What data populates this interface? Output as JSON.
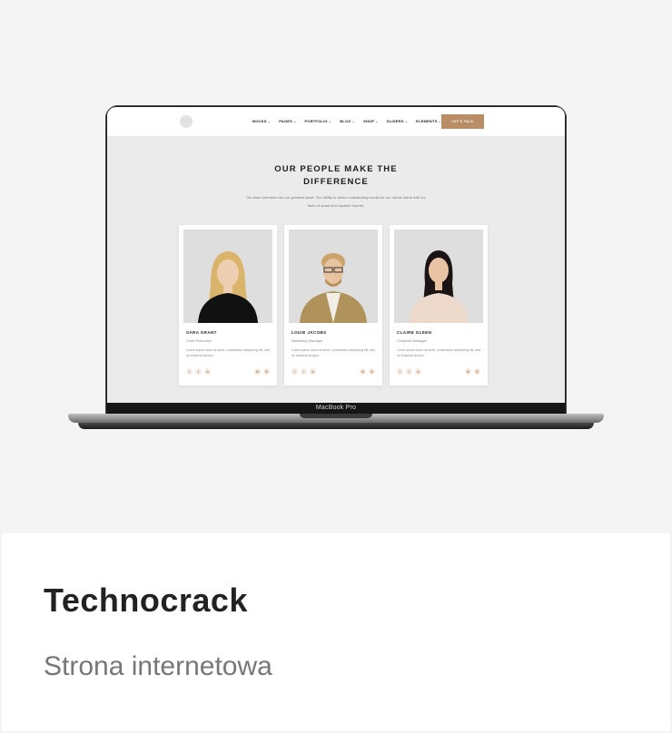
{
  "site": {
    "nav": [
      "BOOKS",
      "PAGES",
      "PORTFOLIO",
      "BLOG",
      "SHOP",
      "SLIDERS",
      "ELEMENTS"
    ],
    "cta": "LET'S TALK",
    "section_title_line1": "OUR PEOPLE MAKE THE",
    "section_title_line2": "DIFFERENCE",
    "section_sub": "Our team members are our greatest asset. Our ability to deliver outstanding results for our clients starts with our team of smart and capable experts.",
    "team": [
      {
        "name": "SARA GRANT",
        "role": "Chief Executive",
        "text": "Lorem ipsum dolor sit amet, consectetur adipiscing elit, sed do eiusmod tempor."
      },
      {
        "name": "LOUIE JACOBS",
        "role": "Marketing Manager",
        "text": "Lorem ipsum dolor sit amet, consectetur adipiscing elit, sed do eiusmod tempor."
      },
      {
        "name": "CLAIRE GLEEN",
        "role": "Financial Manager",
        "text": "Lorem ipsum dolor sit amet, consectetur adipiscing elit, sed do eiusmod tempor."
      }
    ],
    "social_icons": [
      "facebook-icon",
      "twitter-icon",
      "linkedin-icon",
      "mail-icon",
      "phone-icon"
    ],
    "accent_color": "#b98e67"
  },
  "device": {
    "label": "MacBook Pro"
  },
  "caption": {
    "title": "Technocrack",
    "subtitle": "Strona internetowa"
  }
}
